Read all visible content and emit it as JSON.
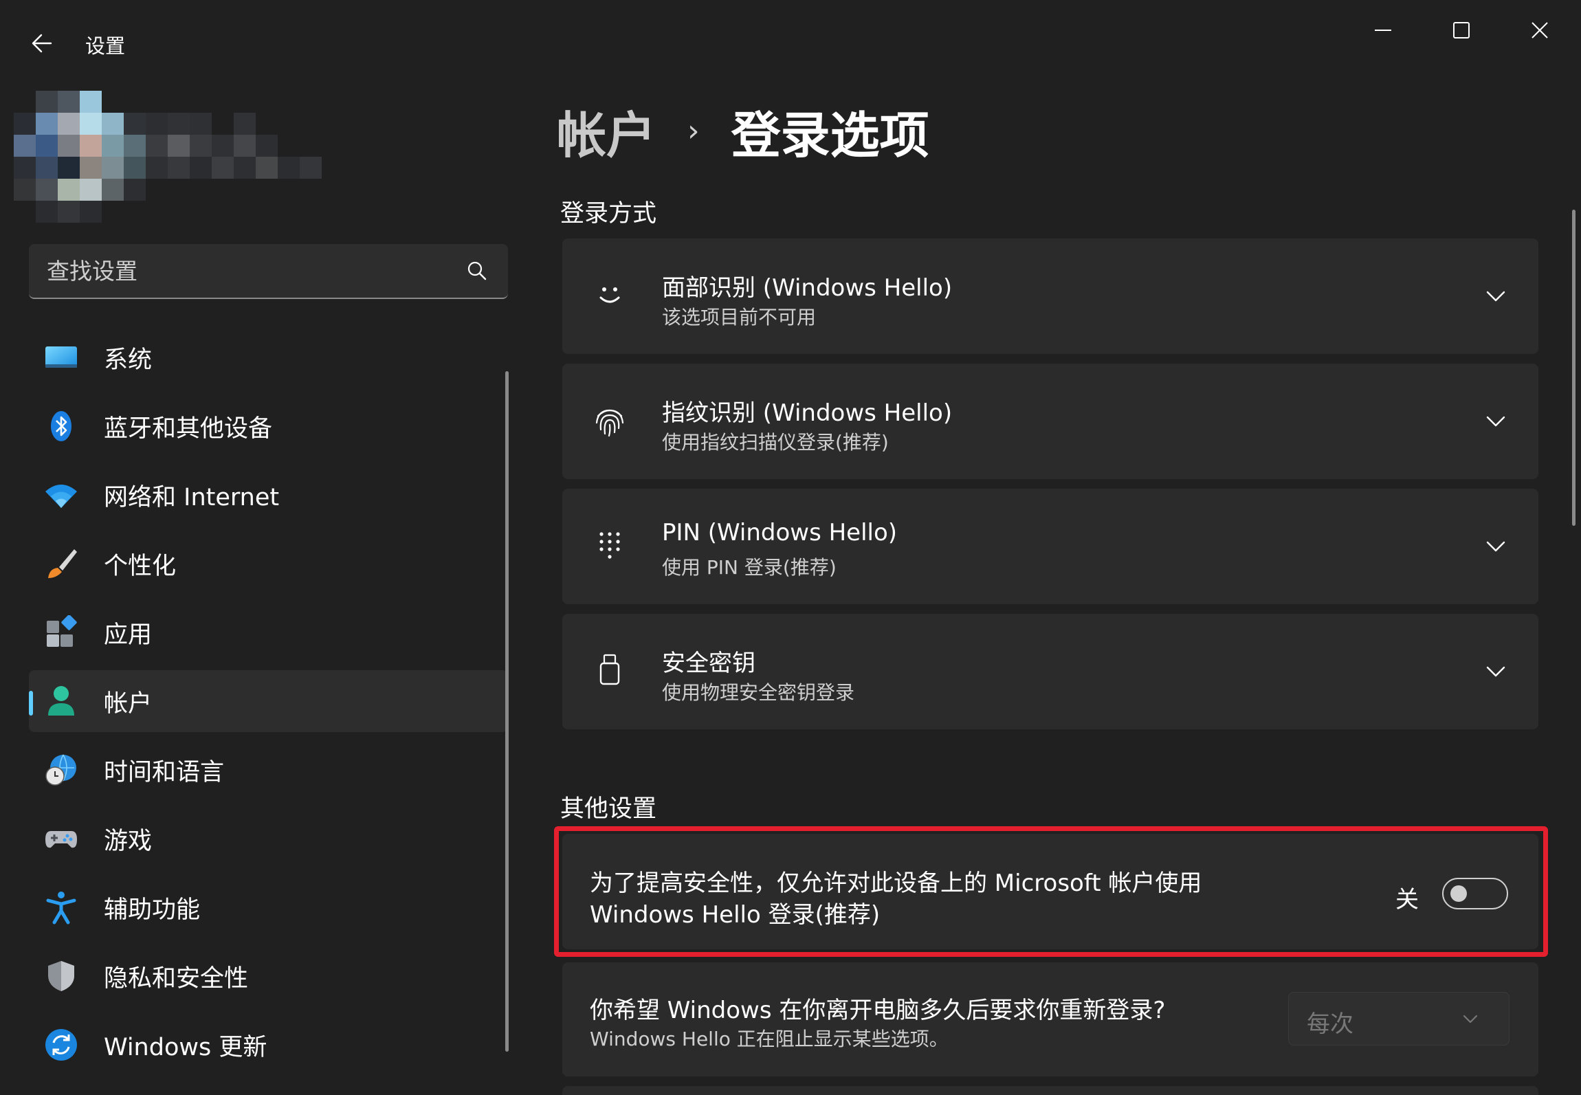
{
  "window": {
    "title": "设置",
    "back_icon": "arrow-left-icon",
    "controls": [
      "minimize-icon",
      "maximize-icon",
      "close-icon"
    ]
  },
  "search": {
    "placeholder": "查找设置",
    "icon": "search-icon"
  },
  "sidebar": {
    "items": [
      {
        "label": "系统",
        "icon": "display-icon",
        "active": false
      },
      {
        "label": "蓝牙和其他设备",
        "icon": "bluetooth-icon",
        "active": false
      },
      {
        "label": "网络和 Internet",
        "icon": "wifi-icon",
        "active": false
      },
      {
        "label": "个性化",
        "icon": "brush-icon",
        "active": false
      },
      {
        "label": "应用",
        "icon": "apps-icon",
        "active": false
      },
      {
        "label": "帐户",
        "icon": "person-icon",
        "active": true
      },
      {
        "label": "时间和语言",
        "icon": "globe-clock-icon",
        "active": false
      },
      {
        "label": "游戏",
        "icon": "gamepad-icon",
        "active": false
      },
      {
        "label": "辅助功能",
        "icon": "accessibility-icon",
        "active": false
      },
      {
        "label": "隐私和安全性",
        "icon": "shield-icon",
        "active": false
      },
      {
        "label": "Windows 更新",
        "icon": "update-icon",
        "active": false
      }
    ]
  },
  "breadcrumb": {
    "parent": "帐户",
    "separator": "›",
    "current": "登录选项"
  },
  "sections": {
    "signin_methods": {
      "title": "登录方式",
      "cards": [
        {
          "title": "面部识别 (Windows Hello)",
          "subtitle": "该选项目前不可用",
          "icon": "face-icon"
        },
        {
          "title": "指纹识别 (Windows Hello)",
          "subtitle": "使用指纹扫描仪登录(推荐)",
          "icon": "fingerprint-icon"
        },
        {
          "title": "PIN (Windows Hello)",
          "subtitle": "使用 PIN 登录(推荐)",
          "icon": "keypad-icon"
        },
        {
          "title": "安全密钥",
          "subtitle": "使用物理安全密钥登录",
          "icon": "usb-key-icon"
        }
      ]
    },
    "other": {
      "title": "其他设置",
      "hello_only": {
        "line1": "为了提高安全性，仅允许对此设备上的 Microsoft 帐户使用",
        "line2": "Windows Hello 登录(推荐)",
        "state_label": "关",
        "on": false
      },
      "relogin": {
        "title": "你希望 Windows 在你离开电脑多久后要求你重新登录?",
        "subtitle": "Windows Hello 正在阻止显示某些选项。",
        "dropdown_value": "每次"
      }
    }
  },
  "colors": {
    "accent": "#60cdff",
    "highlight_border": "#e5202e",
    "background": "#202020",
    "card": "#2b2b2b"
  }
}
